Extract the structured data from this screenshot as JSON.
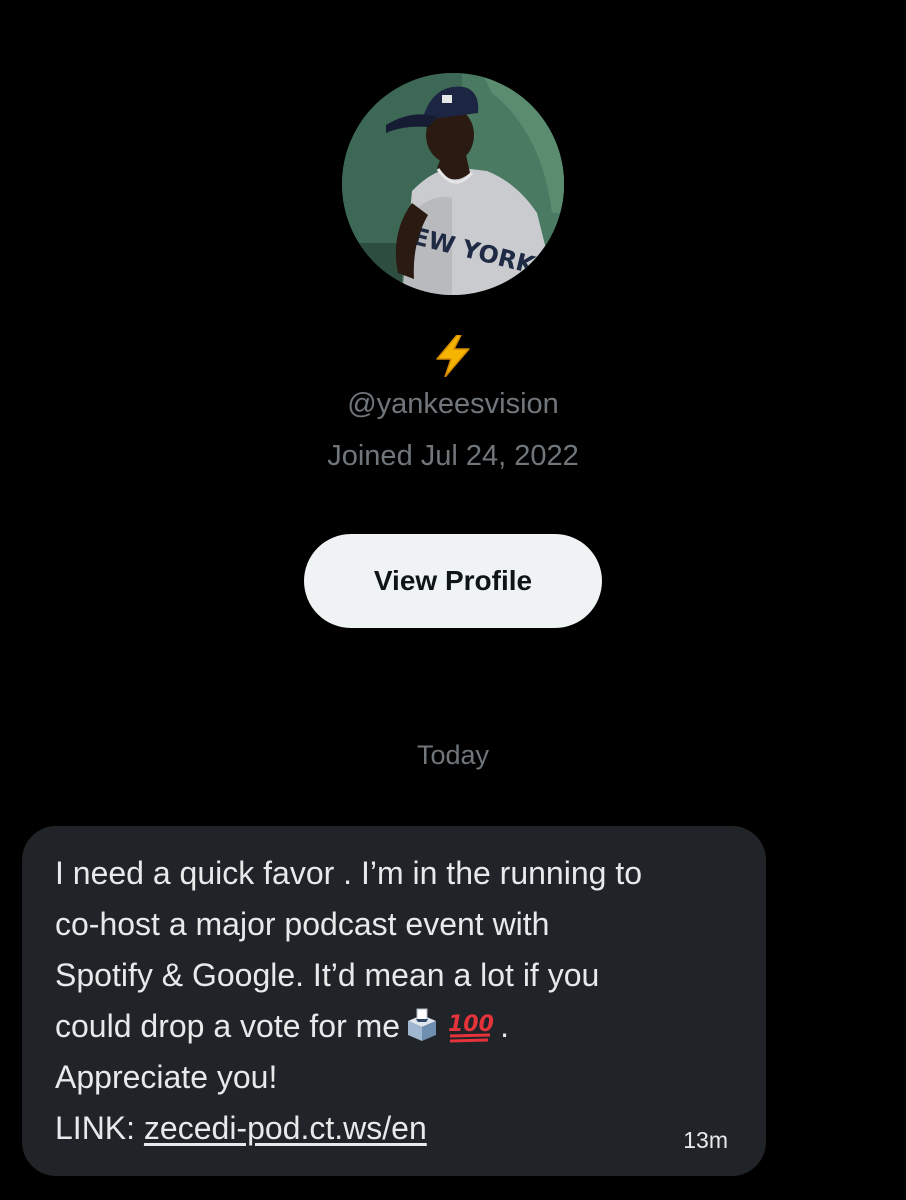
{
  "profile": {
    "avatar_icon": "profile-photo-baseball-player",
    "bio_icon": "lightning-bolt-emoji",
    "handle": "@yankeesvision",
    "joined": "Joined Jul 24, 2022",
    "view_profile_label": "View Profile"
  },
  "conversation": {
    "date_divider": "Today",
    "message": {
      "lines": [
        "I need a quick favor . I’m in the running to",
        "co-host a major podcast event with",
        "Spotify & Google. It’d mean a lot if you",
        "could drop a vote for me",
        ".",
        "Appreciate you!",
        "LINK: "
      ],
      "emoji": [
        "ballot-box-emoji",
        "hundred-points-emoji"
      ],
      "link_text": "zecedi-pod.ct.ws/en",
      "time": "13m"
    }
  },
  "colors": {
    "background": "#000000",
    "bubble": "#202327",
    "secondary_text": "#71767b",
    "button_bg": "#eff3f4"
  }
}
